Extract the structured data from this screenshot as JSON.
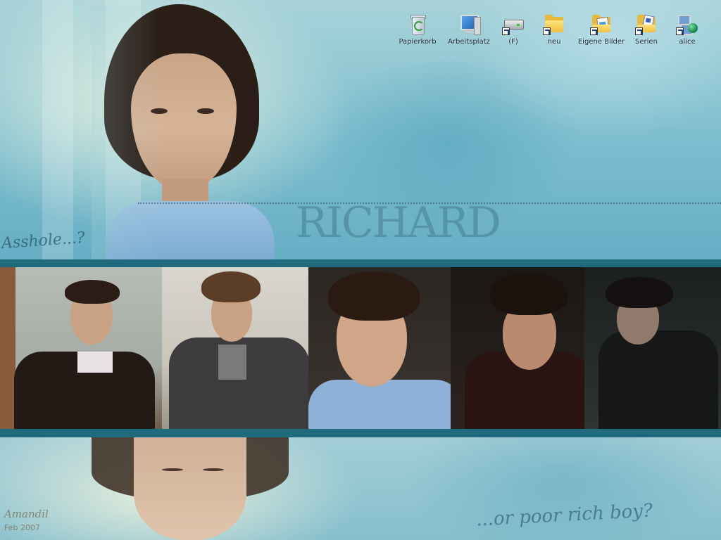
{
  "desktop": {
    "icons": [
      {
        "label": "Papierkorb",
        "icon": "recycle-bin-icon",
        "shortcut": false
      },
      {
        "label": "Arbeitsplatz",
        "icon": "my-computer-icon",
        "shortcut": false
      },
      {
        "label": "(F)",
        "icon": "drive-icon",
        "shortcut": true
      },
      {
        "label": "neu",
        "icon": "folder-icon",
        "shortcut": true
      },
      {
        "label": "Eigene Bilder",
        "icon": "pictures-folder-icon",
        "shortcut": true
      },
      {
        "label": "Serien",
        "icon": "documents-folder-icon",
        "shortcut": true
      },
      {
        "label": "alice",
        "icon": "network-icon",
        "shortcut": true
      }
    ]
  },
  "wallpaper": {
    "title": "RICHARD",
    "script_top": "Asshole...?",
    "script_bottom": "...or poor rich boy?",
    "signature_name": "Amandil",
    "signature_date": "Feb 2007"
  },
  "colors": {
    "stripe": "#1f6b7d",
    "sky": "#7cbdcf",
    "folder": "#f0c044"
  }
}
